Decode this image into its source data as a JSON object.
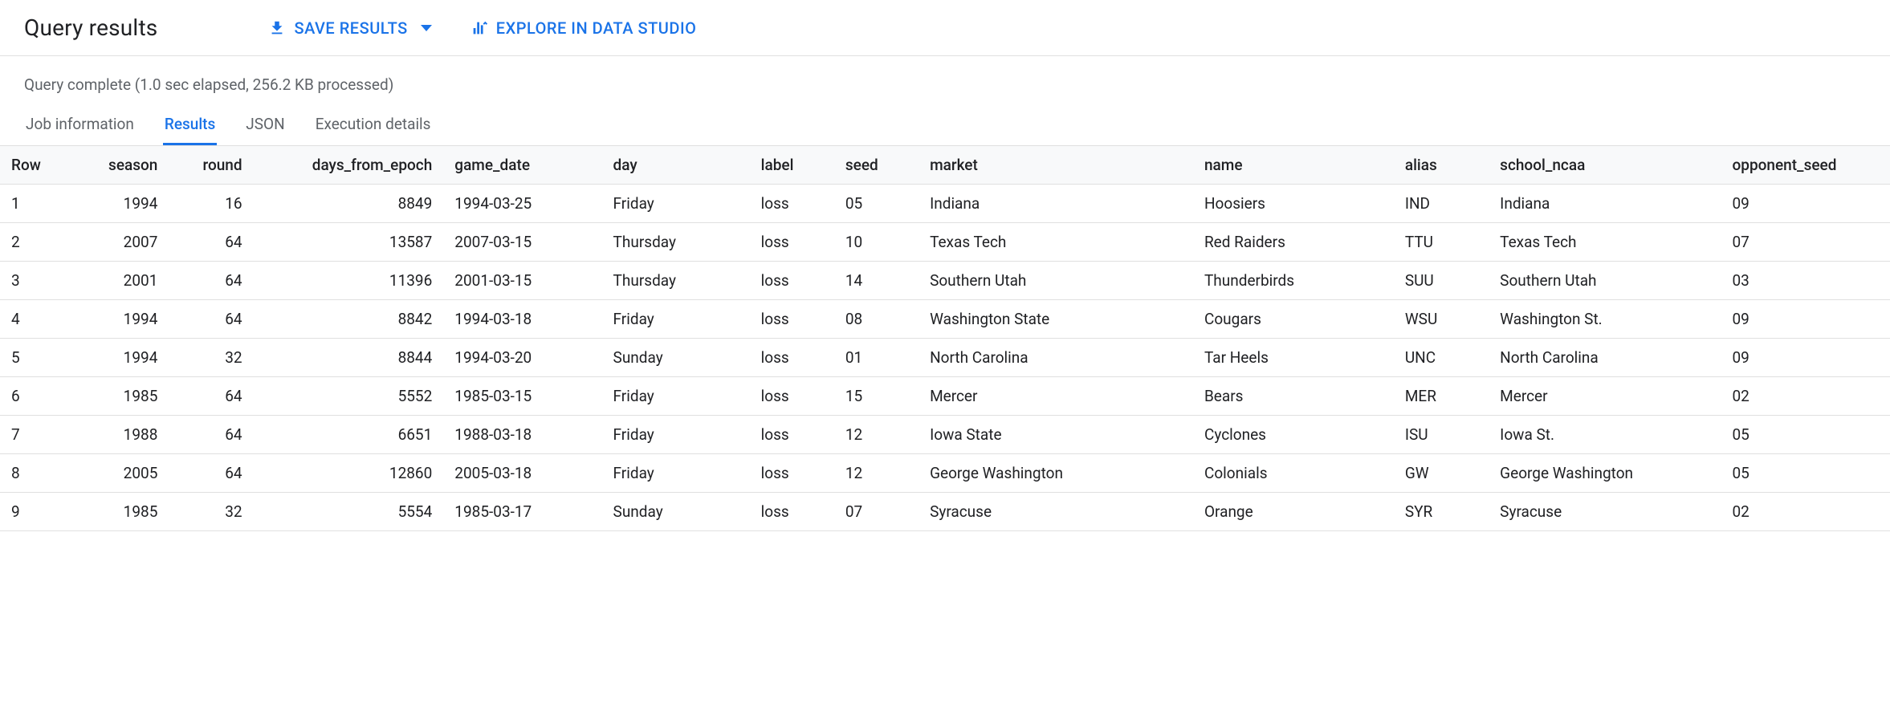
{
  "header": {
    "title": "Query results",
    "save_results_label": "SAVE RESULTS",
    "explore_label": "EXPLORE IN DATA STUDIO"
  },
  "status": {
    "text": "Query complete (1.0 sec elapsed, 256.2 KB processed)"
  },
  "tabs": {
    "job_info": "Job information",
    "results": "Results",
    "json": "JSON",
    "execution": "Execution details"
  },
  "table": {
    "headers": {
      "row": "Row",
      "season": "season",
      "round": "round",
      "days_from_epoch": "days_from_epoch",
      "game_date": "game_date",
      "day": "day",
      "label": "label",
      "seed": "seed",
      "market": "market",
      "name": "name",
      "alias": "alias",
      "school_ncaa": "school_ncaa",
      "opponent_seed": "opponent_seed"
    },
    "rows": [
      {
        "row": "1",
        "season": "1994",
        "round": "16",
        "days_from_epoch": "8849",
        "game_date": "1994-03-25",
        "day": "Friday",
        "label": "loss",
        "seed": "05",
        "market": "Indiana",
        "name": "Hoosiers",
        "alias": "IND",
        "school_ncaa": "Indiana",
        "opponent_seed": "09"
      },
      {
        "row": "2",
        "season": "2007",
        "round": "64",
        "days_from_epoch": "13587",
        "game_date": "2007-03-15",
        "day": "Thursday",
        "label": "loss",
        "seed": "10",
        "market": "Texas Tech",
        "name": "Red Raiders",
        "alias": "TTU",
        "school_ncaa": "Texas Tech",
        "opponent_seed": "07"
      },
      {
        "row": "3",
        "season": "2001",
        "round": "64",
        "days_from_epoch": "11396",
        "game_date": "2001-03-15",
        "day": "Thursday",
        "label": "loss",
        "seed": "14",
        "market": "Southern Utah",
        "name": "Thunderbirds",
        "alias": "SUU",
        "school_ncaa": "Southern Utah",
        "opponent_seed": "03"
      },
      {
        "row": "4",
        "season": "1994",
        "round": "64",
        "days_from_epoch": "8842",
        "game_date": "1994-03-18",
        "day": "Friday",
        "label": "loss",
        "seed": "08",
        "market": "Washington State",
        "name": "Cougars",
        "alias": "WSU",
        "school_ncaa": "Washington St.",
        "opponent_seed": "09"
      },
      {
        "row": "5",
        "season": "1994",
        "round": "32",
        "days_from_epoch": "8844",
        "game_date": "1994-03-20",
        "day": "Sunday",
        "label": "loss",
        "seed": "01",
        "market": "North Carolina",
        "name": "Tar Heels",
        "alias": "UNC",
        "school_ncaa": "North Carolina",
        "opponent_seed": "09"
      },
      {
        "row": "6",
        "season": "1985",
        "round": "64",
        "days_from_epoch": "5552",
        "game_date": "1985-03-15",
        "day": "Friday",
        "label": "loss",
        "seed": "15",
        "market": "Mercer",
        "name": "Bears",
        "alias": "MER",
        "school_ncaa": "Mercer",
        "opponent_seed": "02"
      },
      {
        "row": "7",
        "season": "1988",
        "round": "64",
        "days_from_epoch": "6651",
        "game_date": "1988-03-18",
        "day": "Friday",
        "label": "loss",
        "seed": "12",
        "market": "Iowa State",
        "name": "Cyclones",
        "alias": "ISU",
        "school_ncaa": "Iowa St.",
        "opponent_seed": "05"
      },
      {
        "row": "8",
        "season": "2005",
        "round": "64",
        "days_from_epoch": "12860",
        "game_date": "2005-03-18",
        "day": "Friday",
        "label": "loss",
        "seed": "12",
        "market": "George Washington",
        "name": "Colonials",
        "alias": "GW",
        "school_ncaa": "George Washington",
        "opponent_seed": "05"
      },
      {
        "row": "9",
        "season": "1985",
        "round": "32",
        "days_from_epoch": "5554",
        "game_date": "1985-03-17",
        "day": "Sunday",
        "label": "loss",
        "seed": "07",
        "market": "Syracuse",
        "name": "Orange",
        "alias": "SYR",
        "school_ncaa": "Syracuse",
        "opponent_seed": "02"
      }
    ]
  }
}
